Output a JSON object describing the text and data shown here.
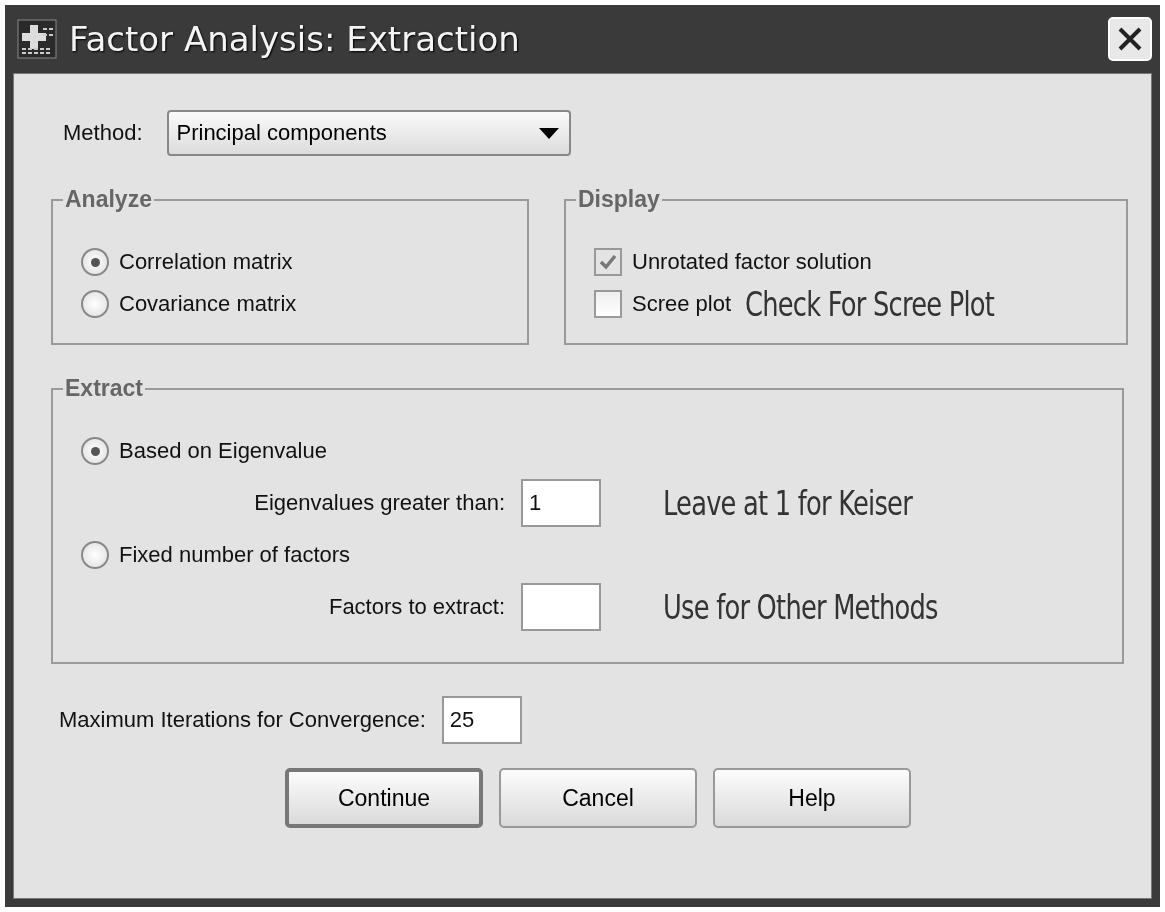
{
  "window": {
    "title": "Factor Analysis: Extraction"
  },
  "method": {
    "label": "Method:",
    "value": "Principal components"
  },
  "analyze": {
    "title": "Analyze",
    "options": [
      {
        "label": "Correlation matrix",
        "selected": true
      },
      {
        "label": "Covariance matrix",
        "selected": false
      }
    ]
  },
  "display": {
    "title": "Display",
    "options": [
      {
        "label": "Unrotated factor solution",
        "checked": true,
        "disabled": true
      },
      {
        "label": "Scree plot",
        "checked": false,
        "disabled": false,
        "annotation": "Check For Scree Plot"
      }
    ]
  },
  "extract": {
    "title": "Extract",
    "options": [
      {
        "label": "Based on Eigenvalue",
        "selected": true,
        "field_label": "Eigenvalues greater than:",
        "value": "1",
        "annotation": "Leave at 1 for Keiser"
      },
      {
        "label": "Fixed number of factors",
        "selected": false,
        "field_label": "Factors to extract:",
        "annotation": "Use for Other Methods"
      }
    ]
  },
  "max_iterations": {
    "label": "Maximum Iterations for Convergence:",
    "value": "25"
  },
  "buttons": [
    {
      "label": "Continue",
      "default": true
    },
    {
      "label": "Cancel",
      "default": false
    },
    {
      "label": "Help",
      "default": false
    }
  ]
}
